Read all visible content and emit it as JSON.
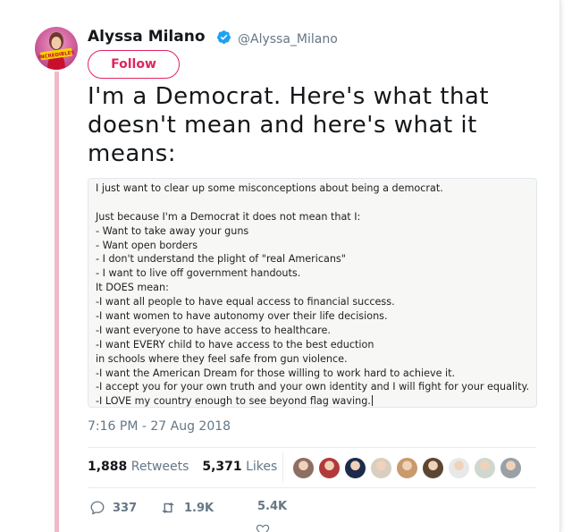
{
  "author": {
    "name": "Alyssa Milano",
    "handle": "@Alyssa_Milano",
    "avatar_caption": "INCREDIBLES",
    "verified_icon": "verified-badge-icon"
  },
  "follow_label": "Follow",
  "tweet_text": "I'm a Democrat. Here's what that doesn't mean and here's what it means:",
  "media_text_lines": [
    "I just want to clear up some misconceptions about being a democrat.",
    "",
    "Just because I'm a Democrat it does not mean that I:",
    "- Want to take away your guns",
    "- Want open borders",
    "- I don't understand the plight of \"real Americans\"",
    "- I want to live off government handouts.",
    "It DOES mean:",
    "-I want all people to have equal access to financial success.",
    "-I want women to have autonomy over their life decisions.",
    "-I want everyone to have access to healthcare.",
    "-I want EVERY child to have access to the best eduction",
    "in schools where they feel safe from gun violence.",
    "-I want the American Dream for those willing to work hard to achieve it.",
    "-I accept you for your own truth and your own identity and I will fight for your equality.",
    "-I LOVE my country enough to see beyond flag waving."
  ],
  "timestamp": "7:16 PM - 27 Aug 2018",
  "stats": {
    "retweets_count": "1,888",
    "retweets_label": "Retweets",
    "likes_count": "5,371",
    "likes_label": "Likes"
  },
  "liker_avatar_colors": [
    "#8d6e63",
    "#b23a3a",
    "#1c2b4a",
    "#d8cfc0",
    "#c99a6b",
    "#5a4633",
    "#e8e8e8",
    "#cfd8cf",
    "#9aa0a6"
  ],
  "actions": {
    "reply_count": "337",
    "retweet_count": "1.9K",
    "like_count": "5.4K"
  },
  "colors": {
    "accent": "#e0245e",
    "verified": "#1da1f2",
    "secondary_text": "#657786",
    "thread_line": "#f1b8c8"
  }
}
